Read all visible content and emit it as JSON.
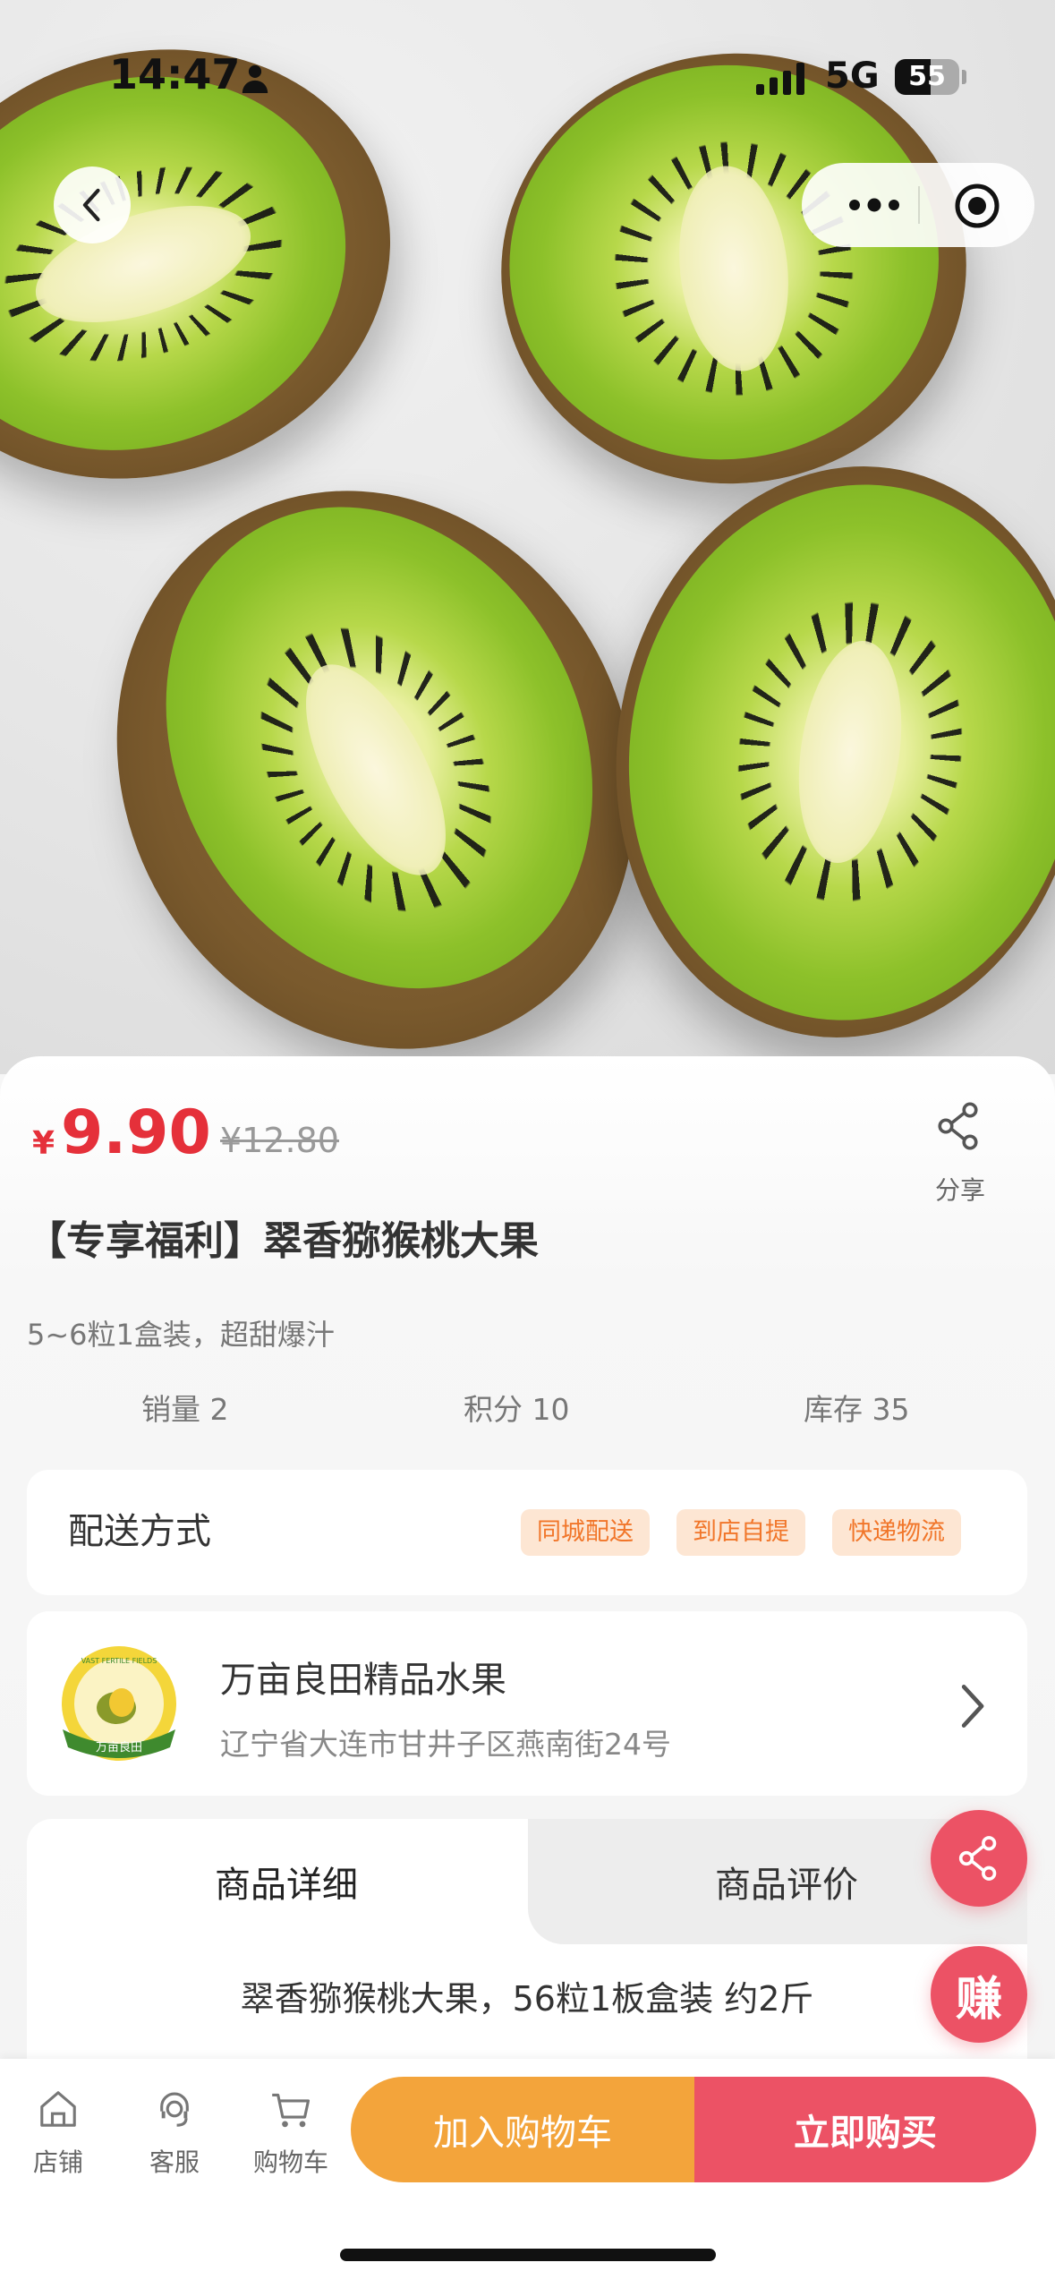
{
  "status_bar": {
    "time": "14:47",
    "network": "5G",
    "battery_level": "55",
    "battery_fraction": 0.55
  },
  "product": {
    "currency_symbol": "¥",
    "price": "9.90",
    "original_price": "¥12.80",
    "title": "【专享福利】翠香猕猴桃大果",
    "subtitle": "5~6粒1盒装，超甜爆汁",
    "share_label": "分享",
    "stats": [
      {
        "label": "销量 2"
      },
      {
        "label": "积分 10"
      },
      {
        "label": "库存 35"
      }
    ]
  },
  "delivery": {
    "label": "配送方式",
    "options": [
      "同城配送",
      "到店自提",
      "快递物流"
    ]
  },
  "store": {
    "name": "万亩良田精品水果",
    "address": "辽宁省大连市甘井子区燕南街24号",
    "logo_text_top": "VAST FERTILE FIELDS",
    "logo_text_bottom": "万亩良田"
  },
  "tabs": {
    "active": "商品详细",
    "inactive": "商品评价",
    "detail_text": "翠香猕猴桃大果，56粒1板盒装 约2斤"
  },
  "floating": {
    "earn_label": "赚"
  },
  "bottom_nav": {
    "items": [
      {
        "label": "店铺",
        "icon": "store-icon"
      },
      {
        "label": "客服",
        "icon": "customer-service-icon"
      },
      {
        "label": "购物车",
        "icon": "cart-icon"
      }
    ],
    "add_to_cart": "加入购物车",
    "buy_now": "立即购买"
  },
  "colors": {
    "price_red": "#e5303a",
    "buy_red": "#ec5265",
    "cart_orange": "#f3a43b",
    "tag_bg": "#fde6d3",
    "tag_text": "#f1762a"
  }
}
